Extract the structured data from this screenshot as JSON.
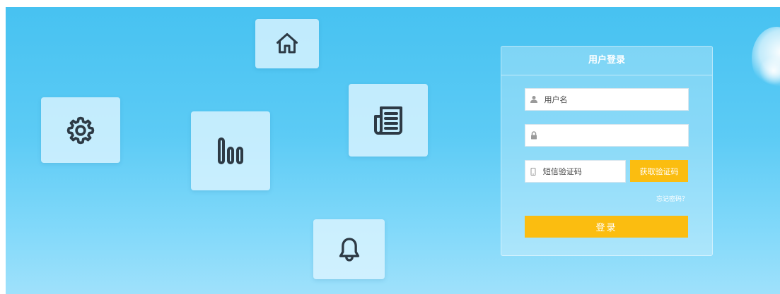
{
  "tiles": [
    {
      "icon": "home-icon"
    },
    {
      "icon": "settings-icon"
    },
    {
      "icon": "chart-icon"
    },
    {
      "icon": "news-icon"
    },
    {
      "icon": "bell-icon"
    }
  ],
  "login": {
    "title": "用户登录",
    "username_placeholder": "用户名",
    "password_placeholder": "",
    "sms_placeholder": "短信验证码",
    "sms_button": "获取验证码",
    "forgot": "忘记密码？",
    "submit": "登录"
  },
  "colors": {
    "sky_top": "#47c2f1",
    "sky_bottom": "#9fe1fb",
    "accent": "#fbbd10"
  }
}
